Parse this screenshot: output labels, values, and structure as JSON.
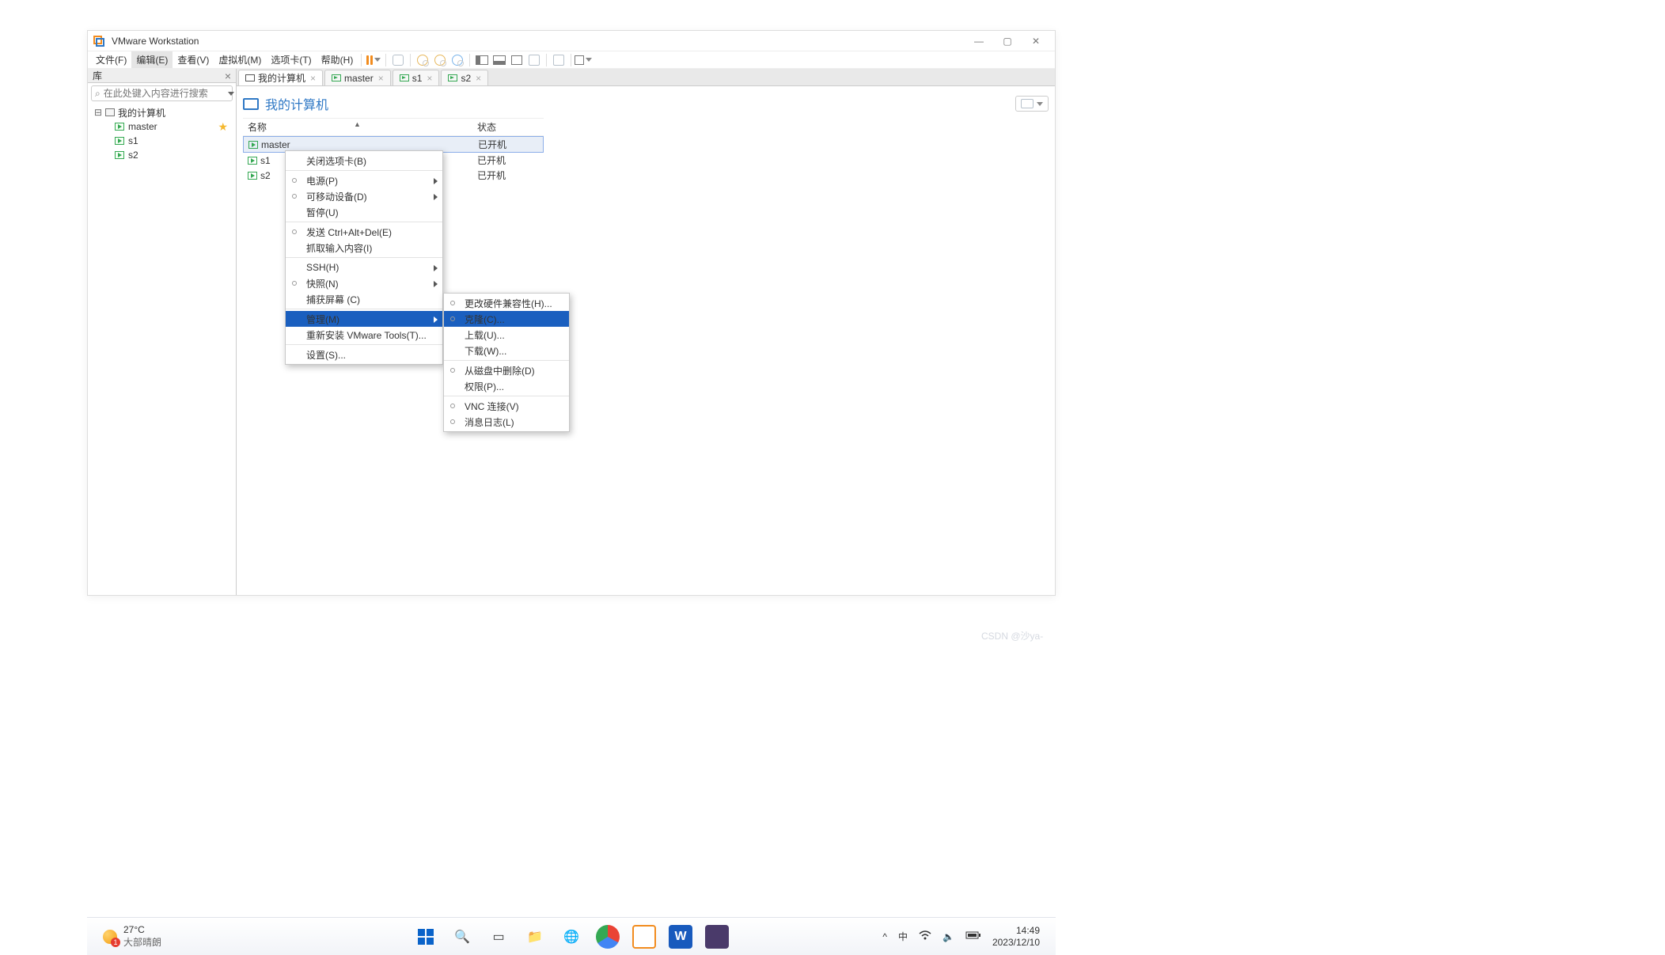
{
  "app": {
    "title": "VMware Workstation"
  },
  "win_controls": {
    "min": "—",
    "max": "▢",
    "close": "✕"
  },
  "menubar": {
    "items": [
      "文件(F)",
      "编辑(E)",
      "查看(V)",
      "虚拟机(M)",
      "选项卡(T)",
      "帮助(H)"
    ],
    "active_index": 1
  },
  "sidebar": {
    "header": "库",
    "search_placeholder": "在此处键入内容进行搜索",
    "root": "我的计算机",
    "items": [
      "master",
      "s1",
      "s2"
    ]
  },
  "tabs": [
    {
      "label": "我的计算机",
      "kind": "monitor"
    },
    {
      "label": "master",
      "kind": "vm"
    },
    {
      "label": "s1",
      "kind": "vm"
    },
    {
      "label": "s2",
      "kind": "vm"
    }
  ],
  "content": {
    "title": "我的计算机",
    "columns": {
      "name": "名称",
      "status": "状态"
    },
    "rows": [
      {
        "name": "master",
        "status": "已开机",
        "selected": true
      },
      {
        "name": "s1",
        "status": "已开机"
      },
      {
        "name": "s2",
        "status": "已开机"
      }
    ]
  },
  "context_menu_1": {
    "items": [
      {
        "label": "关闭选项卡(B)"
      },
      {
        "sep": true
      },
      {
        "label": "电源(P)",
        "dot": true,
        "sub": true
      },
      {
        "label": "可移动设备(D)",
        "dot": true,
        "sub": true
      },
      {
        "label": "暂停(U)"
      },
      {
        "sep": true
      },
      {
        "label": "发送 Ctrl+Alt+Del(E)",
        "dot": true
      },
      {
        "label": "抓取输入内容(I)"
      },
      {
        "sep": true
      },
      {
        "label": "SSH(H)",
        "sub": true
      },
      {
        "label": "快照(N)",
        "dot": true,
        "sub": true
      },
      {
        "label": "捕获屏幕 (C)"
      },
      {
        "sep": true
      },
      {
        "label": "管理(M)",
        "sub": true,
        "highlight": true
      },
      {
        "label": "重新安装 VMware Tools(T)...",
        "disabled": true
      },
      {
        "sep": true
      },
      {
        "label": "设置(S)..."
      }
    ]
  },
  "context_menu_2": {
    "items": [
      {
        "label": "更改硬件兼容性(H)...",
        "dot": true,
        "disabled": true
      },
      {
        "label": "克隆(C)...",
        "dot": true,
        "highlight": true
      },
      {
        "label": "上载(U)...",
        "disabled": true
      },
      {
        "label": "下载(W)...",
        "disabled": true
      },
      {
        "sep": true
      },
      {
        "label": "从磁盘中删除(D)",
        "dot": true,
        "disabled": true
      },
      {
        "label": "权限(P)...",
        "disabled": true
      },
      {
        "sep": true
      },
      {
        "label": "VNC 连接(V)",
        "dot": true
      },
      {
        "label": "消息日志(L)",
        "dot": true
      }
    ]
  },
  "watermark": "CSDN @沙ya-",
  "taskbar": {
    "weather": {
      "temp": "27°C",
      "desc": "大部晴朗"
    },
    "systray": {
      "arrow": "^",
      "ime": "中",
      "wifi": "wifi-icon",
      "vol": "volume-icon",
      "bat": "battery-icon"
    },
    "clock": {
      "time": "14:49",
      "date": "2023/12/10"
    }
  }
}
